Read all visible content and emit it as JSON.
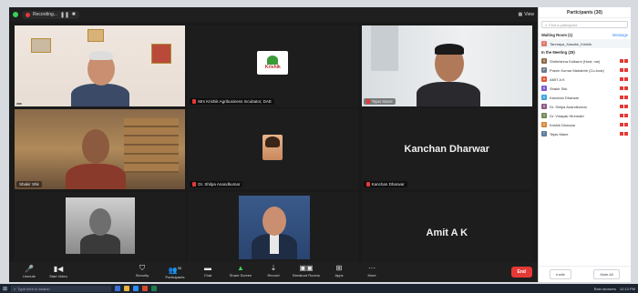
{
  "window": {
    "recording_label": "Recording...",
    "view_label": "View"
  },
  "tiles": [
    {
      "name": "",
      "big_name": "",
      "muted": false
    },
    {
      "name": "Mrs Krishik Agribusiness Incubator, DAE",
      "big_name": "",
      "logo_text": "Krishik",
      "muted": true
    },
    {
      "name": "Tejas Mane",
      "big_name": "",
      "muted": true
    },
    {
      "name": "Shakir Shk",
      "big_name": "",
      "muted": false
    },
    {
      "name": "Dr. Shilpa Anandkumar",
      "big_name": "",
      "muted": true
    },
    {
      "name": "Kanchan Dharwar",
      "big_name": "Kanchan Dharwar",
      "muted": true
    },
    {
      "name": "Pravin Kumar Mahabhir",
      "big_name": "",
      "muted": true
    },
    {
      "name": "Dr. Vinayak Hiremath",
      "big_name": "",
      "muted": true
    },
    {
      "name": "Amit A K",
      "big_name": "Amit A K",
      "muted": false
    }
  ],
  "toolbar": {
    "items": [
      {
        "label": "Unmute",
        "icon": "microphone-icon"
      },
      {
        "label": "Start Video",
        "icon": "video-camera-icon"
      }
    ],
    "center_items": [
      {
        "label": "Security",
        "icon": "shield-icon"
      },
      {
        "label": "Participants",
        "icon": "participants-icon",
        "count": "30"
      },
      {
        "label": "Chat",
        "icon": "chat-icon"
      },
      {
        "label": "Share Screen",
        "icon": "share-screen-icon"
      },
      {
        "label": "Record",
        "icon": "record-icon"
      },
      {
        "label": "Breakout Rooms",
        "icon": "breakout-icon"
      },
      {
        "label": "Apps",
        "icon": "apps-icon"
      },
      {
        "label": "More",
        "icon": "more-icon"
      }
    ],
    "end_label": "End"
  },
  "panel": {
    "title": "Participants (30)",
    "search_placeholder": "Find a participant",
    "waiting_header": "Waiting Room (1)",
    "waiting_action": "Message",
    "waiting_person": "Tanmaya_Kasabe_Krishik",
    "meeting_header": "In the Meeting (29)",
    "participants": [
      {
        "name": "Shrikrishna Kulkarni (Host, me)",
        "color": "#8a6a4a"
      },
      {
        "name": "Pravin Kumar Mahabhir (Co-host)",
        "color": "#6b7b8c"
      },
      {
        "name": "AMIT A K",
        "color": "#e0563b"
      },
      {
        "name": "Shakir Shk",
        "color": "#7a5bd6"
      },
      {
        "name": "Kanchan Dharwar",
        "color": "#3fa6d9"
      },
      {
        "name": "Dr. Shilpa Anandkumar",
        "color": "#8a5a8a"
      },
      {
        "name": "Dr. Vinayak Hiremath",
        "color": "#6e8a55"
      },
      {
        "name": "Krishik Dharwar",
        "color": "#d4883a"
      },
      {
        "name": "Tejas Mane",
        "color": "#5a7a99"
      }
    ],
    "invite_label": "Invite",
    "mute_all_label": "Mute All"
  },
  "taskbar": {
    "search_placeholder": "Type here to search",
    "tray_text": "Rain showers",
    "clock": "12:13 PM"
  }
}
